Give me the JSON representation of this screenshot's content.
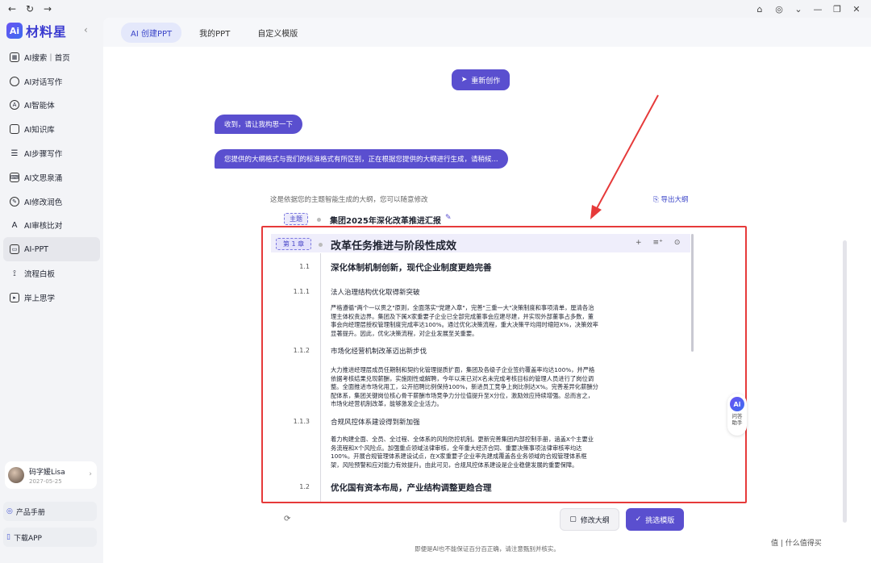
{
  "brand": {
    "logo": "Ai",
    "name": "材料星"
  },
  "sidebar": {
    "items": [
      {
        "icon": "grid-icon",
        "label": "AI搜索｜首页"
      },
      {
        "icon": "chat-icon",
        "label": "AI对话写作"
      },
      {
        "icon": "agent-icon",
        "label": "AI智能体"
      },
      {
        "icon": "book-icon",
        "label": "AI知识库"
      },
      {
        "icon": "list-icon",
        "label": "AI步骤写作"
      },
      {
        "icon": "keyboard-icon",
        "label": "AI文思泉涌"
      },
      {
        "icon": "pen-icon",
        "label": "AI修改润色"
      },
      {
        "icon": "compare-icon",
        "label": "AI审核比对"
      },
      {
        "icon": "ppt-icon",
        "label": "AI-PPT"
      },
      {
        "icon": "flow-icon",
        "label": "流程白板"
      },
      {
        "icon": "video-icon",
        "label": "岸上思学"
      }
    ],
    "active_index": 8,
    "user": {
      "name": "码字媛Lisa",
      "date": "2027-05-25"
    },
    "manual_label": "产品手册",
    "download_label": "下载APP"
  },
  "tabs": [
    {
      "label": "AI 创建PPT",
      "active": true
    },
    {
      "label": "我的PPT",
      "active": false
    },
    {
      "label": "自定义模版",
      "active": false
    }
  ],
  "recreate_label": "重新创作",
  "messages": [
    "收到，请让我构思一下",
    "您提供的大纲格式与我们的标准格式有所区别，正在根据您提供的大纲进行生成，请稍候..."
  ],
  "outline": {
    "hint": "这是依据您的主题智能生成的大纲，您可以随意修改",
    "export_label": "导出大纲",
    "topic_tag": "主题",
    "topic_title": "集团2025年深化改革推进汇报",
    "chapter_tag": "第 1 章",
    "chapter_title": "改革任务推进与阶段性成效",
    "tool_add": "+",
    "tool_sub": "≡⁺",
    "tool_more": "⊙",
    "sec1_num": "1.1",
    "sec1_title": "深化体制机制创新，现代企业制度更趋完善",
    "sub1_num": "1.1.1",
    "sub1_title": "法人治理结构优化取得新突破",
    "sub1_lines": [
      "严格遵循\"两个一以贯之\"原则，全面落实\"党建入章\"，完善\"三重一大\"决策制度和事项清单，厘清各治",
      "理主体权责边界。集团及下属X家重要子企业已全部完成董事会应建尽建，并实现外部董事占多数，董",
      "事会向经理层授权管理制度完成率达100%。通过优化决策流程，重大决策平均用时缩短X%，决策效率",
      "显著提升。因此，优化决策流程，对企业发展至关重要。"
    ],
    "sub2_num": "1.1.2",
    "sub2_title": "市场化经营机制改革迈出新步伐",
    "sub2_lines": [
      "大力推进经理层成员任期制和契约化管理提质扩面，集团及各级子企业签约覆盖率均达100%，并严格",
      "依据考核结果兑现薪酬，实施刚性或解聘，今年以来已对X名未完成考核目标的管理人员进行了岗位调",
      "整。全面推进市场化用工，公开招聘比例保持100%，新进员工竞争上岗比例达X%。完善差异化薪酬分",
      "配体系，集团关键岗位核心骨干薪酬市场竞争力分位值提升至X分位，激励效应持续增强。总而言之，",
      "市场化经营机制改革，能够激发企业活力。"
    ],
    "sub3_num": "1.1.3",
    "sub3_title": "合规风控体系建设得到新加强",
    "sub3_lines": [
      "着力构建全面、全员、全过程、全体系的风险防控机制。更新完善集团内部控制手册，涵盖X个主要业",
      "务流程和X个风险点。加强重点领域法律审核，全年重大经济合同、重要决策事项法律审核率均达",
      "100%。开展合规管理体系建设试点，在X家重要子企业率先建成覆盖各业务领域的合规管理体系框",
      "架，风险预警和应对能力有效提升。由此可见，合规风控体系建设是企业稳健发展的重要保障。"
    ],
    "sec2_num": "1.2",
    "sec2_title": "优化国有资本布局，产业结构调整更趋合理"
  },
  "footer": {
    "edit_outline_label": "修改大纲",
    "choose_template_label": "挑选模版",
    "disclaimer": "即便是AI也不能保证百分百正确，请注意甄别并核实。"
  },
  "assistant": {
    "logo": "Ai",
    "label": "问答助手"
  },
  "watermark": "值 | 什么值得买",
  "colors": {
    "accent": "#5a4fcf",
    "highlight": "#e63a3a"
  }
}
